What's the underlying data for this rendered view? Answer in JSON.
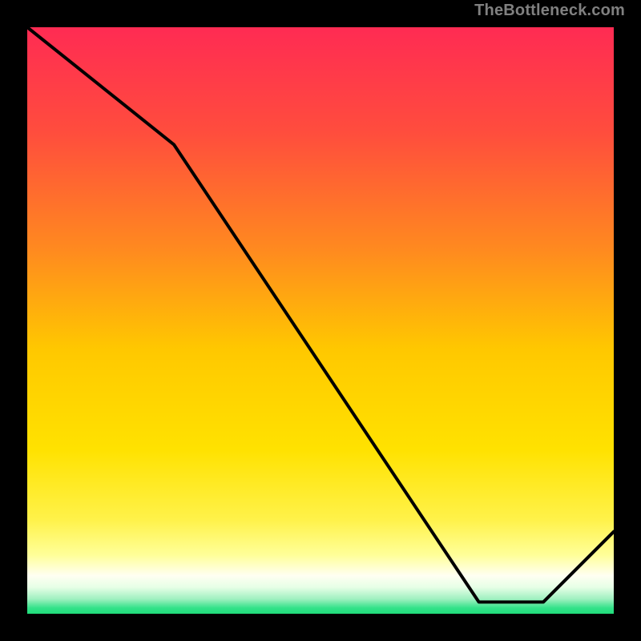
{
  "attribution": "TheBottleneck.com",
  "colors": {
    "background": "#000000",
    "attribution_text": "#808080",
    "curve": "#000000",
    "marker_text": "#cc3322",
    "gradient_stops": [
      {
        "offset": 0,
        "color": "#ff2b53"
      },
      {
        "offset": 0.18,
        "color": "#ff4d3d"
      },
      {
        "offset": 0.38,
        "color": "#ff8a1f"
      },
      {
        "offset": 0.55,
        "color": "#ffc800"
      },
      {
        "offset": 0.72,
        "color": "#ffe200"
      },
      {
        "offset": 0.84,
        "color": "#fff24a"
      },
      {
        "offset": 0.9,
        "color": "#ffff99"
      },
      {
        "offset": 0.935,
        "color": "#fffff2"
      },
      {
        "offset": 0.955,
        "color": "#e6ffe6"
      },
      {
        "offset": 0.975,
        "color": "#9ff0c0"
      },
      {
        "offset": 0.99,
        "color": "#34e28a"
      },
      {
        "offset": 1.0,
        "color": "#20dd7a"
      }
    ]
  },
  "marker": {
    "text": "",
    "x_frac": 0.8,
    "y_frac": 0.985
  },
  "chart_data": {
    "type": "line",
    "title": "",
    "xlabel": "",
    "ylabel": "",
    "xlim": [
      0,
      1
    ],
    "ylim": [
      0,
      1
    ],
    "series": [
      {
        "name": "curve",
        "x": [
          0.0,
          0.25,
          0.77,
          0.88,
          1.0
        ],
        "y": [
          1.0,
          0.8,
          0.02,
          0.02,
          0.14
        ]
      }
    ],
    "annotations": [
      {
        "text": "",
        "x": 0.8,
        "y": 0.015
      }
    ]
  }
}
